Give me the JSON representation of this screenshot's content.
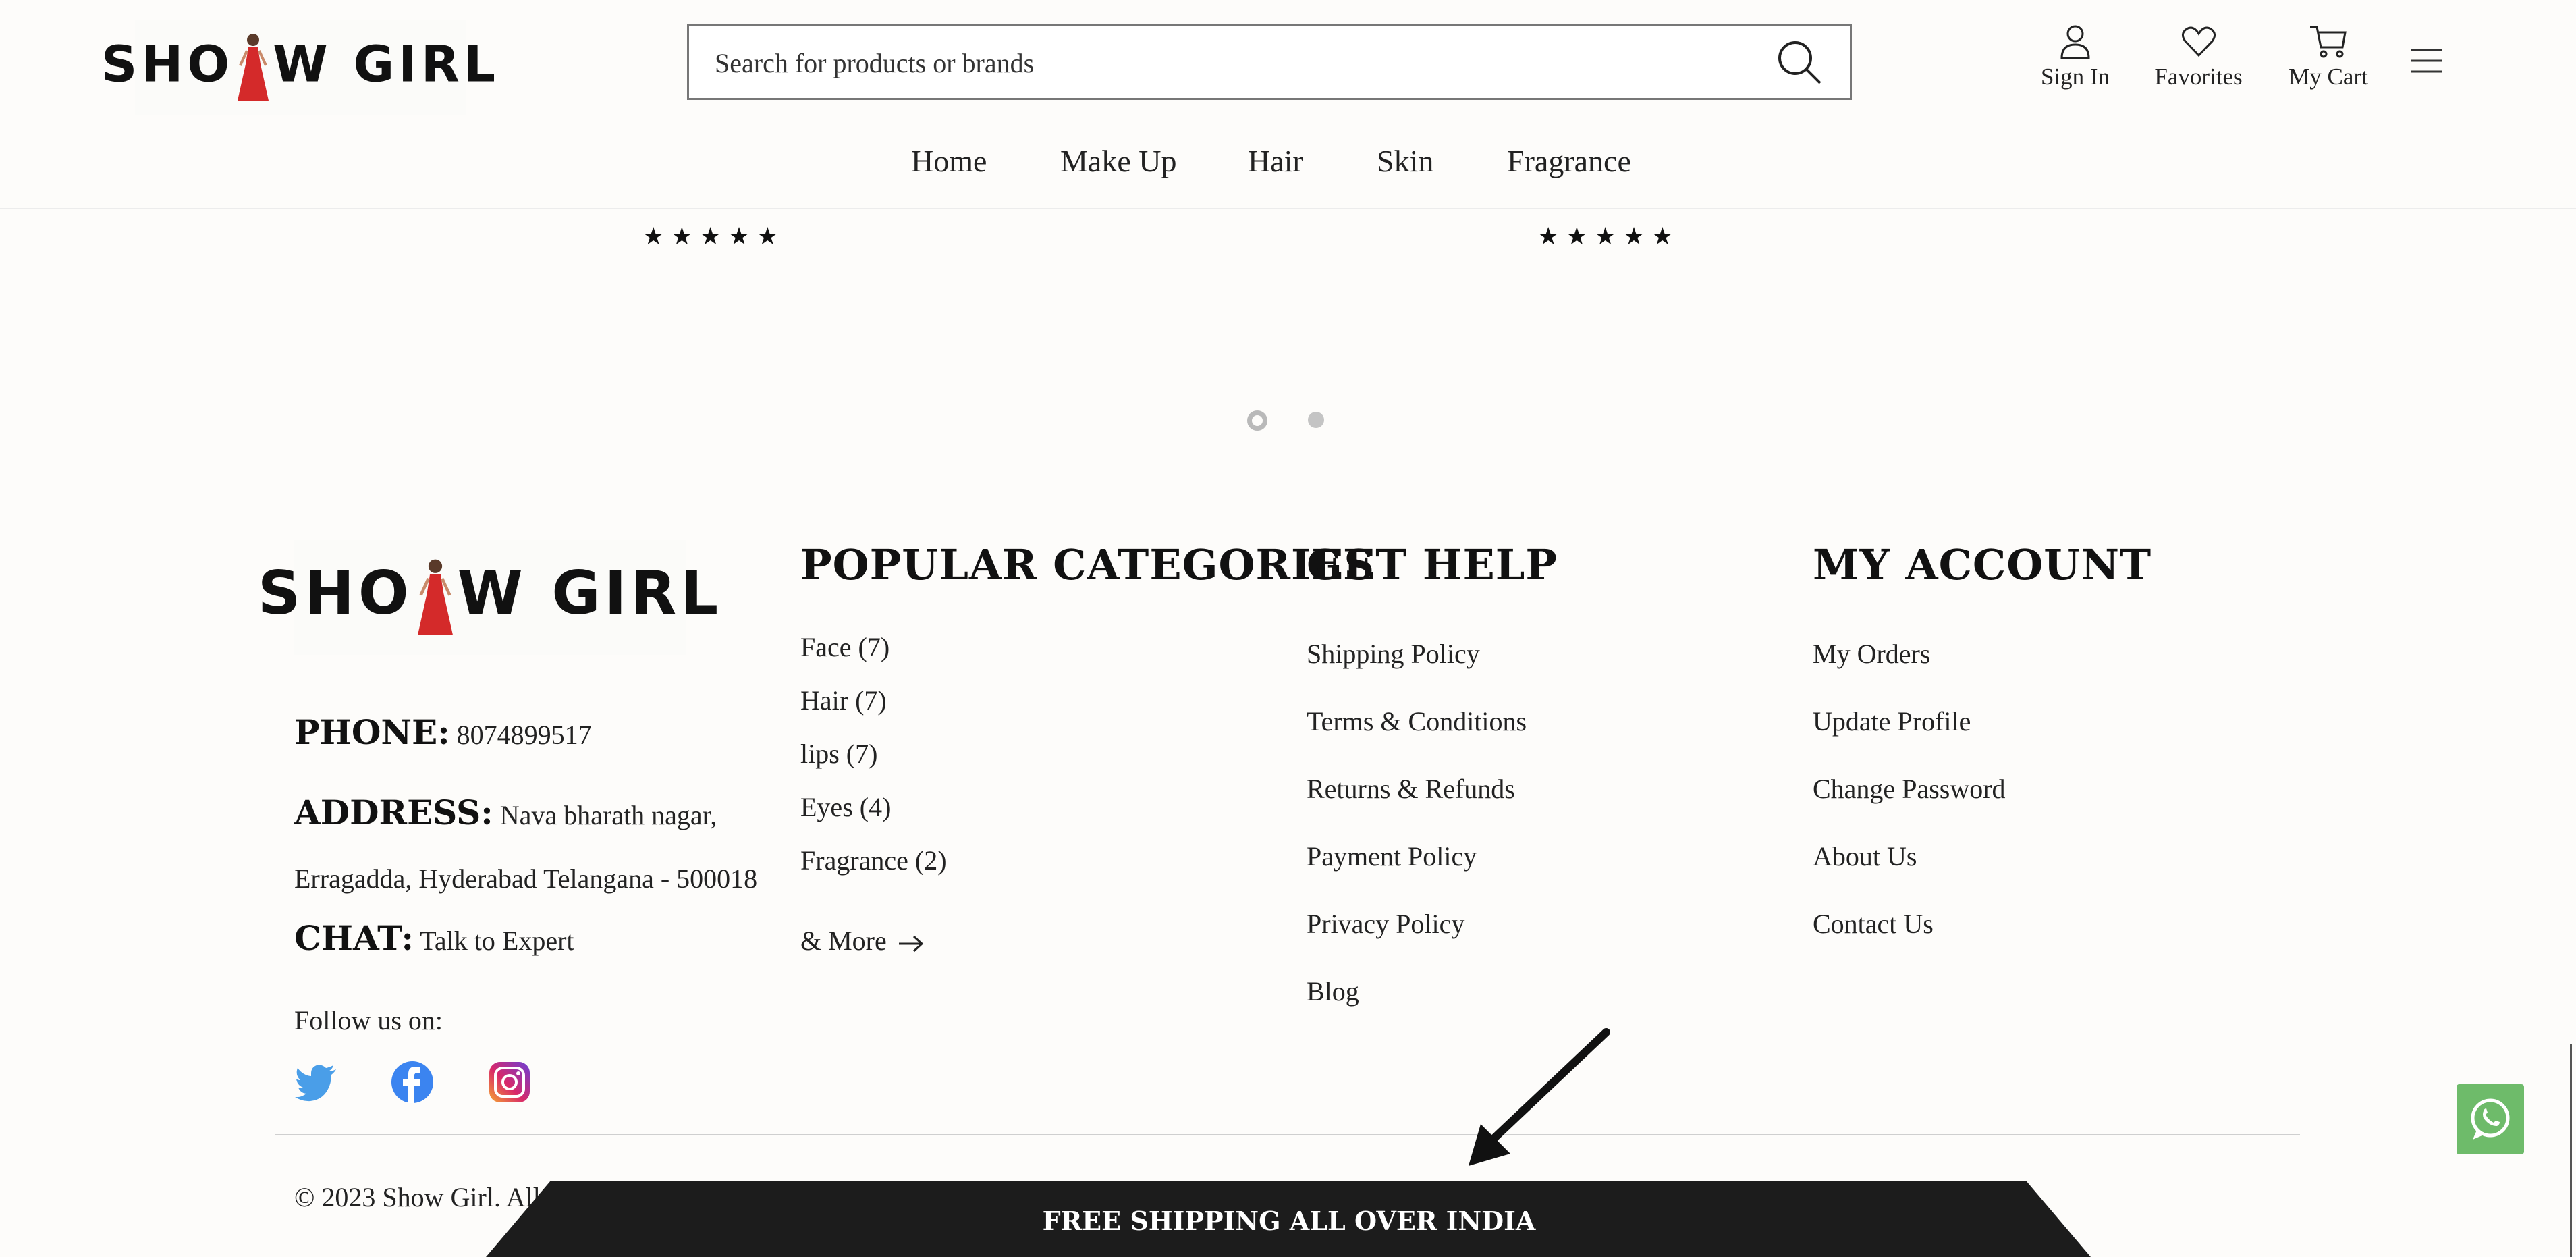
{
  "header": {
    "logo_text_left": "SHO",
    "logo_text_right": "W GIRL",
    "search_placeholder": "Search for products or brands",
    "actions": [
      {
        "label": "Sign In",
        "icon": "user-icon"
      },
      {
        "label": "Favorites",
        "icon": "heart-icon"
      },
      {
        "label": "My Cart",
        "icon": "cart-icon"
      }
    ],
    "menu_icon": "hamburger-menu-icon"
  },
  "nav": {
    "items": [
      "Home",
      "Make Up",
      "Hair",
      "Skin",
      "Fragrance"
    ]
  },
  "carousel": {
    "product_ratings": [
      "★★★★★",
      "★★★★★"
    ],
    "pagination": {
      "total": 2,
      "active": 1
    }
  },
  "footer": {
    "contact": {
      "phone_label": "PHONE:",
      "phone_value": "8074899517",
      "address_label": "ADDRESS:",
      "address_line1": "Nava bharath nagar,",
      "address_line2": "Erragadda, Hyderabad Telangana - 500018",
      "chat_label": "CHAT:",
      "chat_value": "Talk to Expert",
      "follow_label": "Follow us on:",
      "social": [
        "twitter-icon",
        "facebook-icon",
        "instagram-icon"
      ]
    },
    "popular_categories": {
      "heading": "POPULAR CATEGORIES",
      "items": [
        "Face (7)",
        "Hair (7)",
        "lips (7)",
        "Eyes (4)",
        "Fragrance (2)"
      ],
      "more": "& More"
    },
    "get_help": {
      "heading": "GET HELP",
      "items": [
        "Shipping Policy",
        "Terms & Conditions",
        "Returns & Refunds",
        "Payment Policy",
        "Privacy Policy",
        "Blog"
      ]
    },
    "my_account": {
      "heading": "MY ACCOUNT",
      "items": [
        "My Orders",
        "Update Profile",
        "Change Password",
        "About Us",
        "Contact Us"
      ]
    },
    "copyright": "© 2023 Show Girl. All"
  },
  "banner": {
    "text": "FREE SHIPPING ALL OVER INDIA"
  },
  "colors": {
    "background": "#fdfcfa",
    "banner": "#1c1c1c",
    "whatsapp": "#6ebb6a",
    "logo_dress": "#d42a2a",
    "twitter": "#4a9ee8",
    "facebook": "#3b84f0"
  }
}
